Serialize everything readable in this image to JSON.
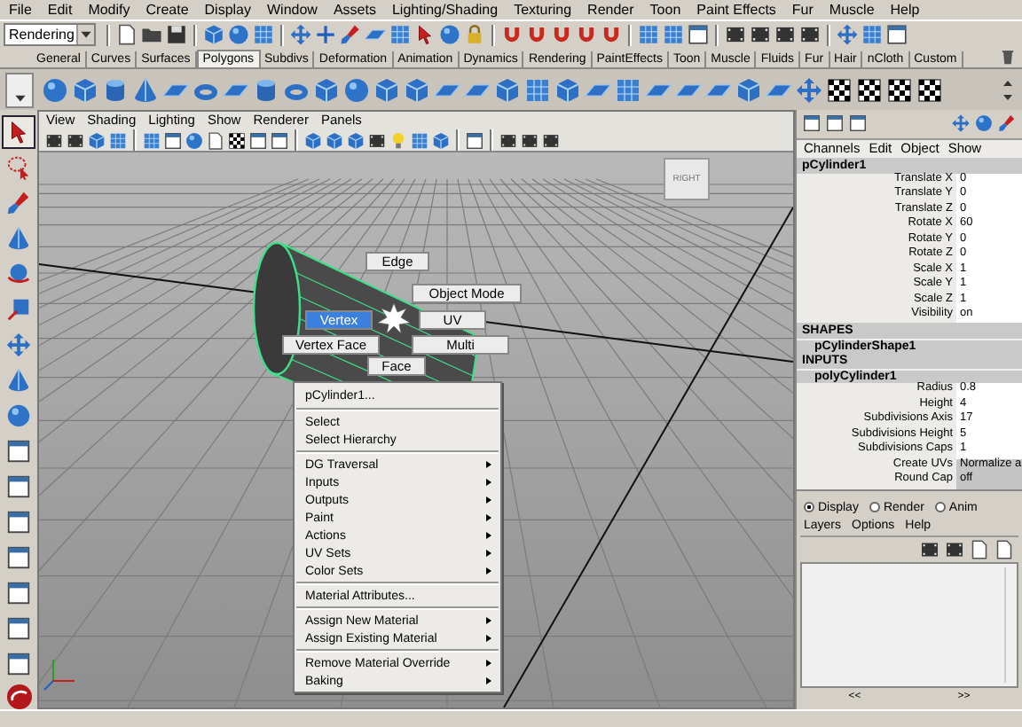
{
  "menubar": [
    "File",
    "Edit",
    "Modify",
    "Create",
    "Display",
    "Window",
    "Assets",
    "Lighting/Shading",
    "Texturing",
    "Render",
    "Toon",
    "Paint Effects",
    "Fur",
    "Muscle",
    "Help"
  ],
  "status_line": {
    "menu_set": "Rendering"
  },
  "shelf_tabs": [
    {
      "label": "General",
      "selected": false
    },
    {
      "label": "Curves",
      "selected": false
    },
    {
      "label": "Surfaces",
      "selected": false
    },
    {
      "label": "Polygons",
      "selected": true
    },
    {
      "label": "Subdivs",
      "selected": false
    },
    {
      "label": "Deformation",
      "selected": false
    },
    {
      "label": "Animation",
      "selected": false
    },
    {
      "label": "Dynamics",
      "selected": false
    },
    {
      "label": "Rendering",
      "selected": false
    },
    {
      "label": "PaintEffects",
      "selected": false
    },
    {
      "label": "Toon",
      "selected": false
    },
    {
      "label": "Muscle",
      "selected": false
    },
    {
      "label": "Fluids",
      "selected": false
    },
    {
      "label": "Fur",
      "selected": false
    },
    {
      "label": "Hair",
      "selected": false
    },
    {
      "label": "nCloth",
      "selected": false
    },
    {
      "label": "Custom",
      "selected": false
    }
  ],
  "toolbox": [
    {
      "selected": true
    },
    {
      "selected": false
    },
    {
      "selected": false
    },
    {
      "selected": false
    },
    {
      "selected": false
    },
    {
      "selected": false
    },
    {
      "selected": false
    },
    {
      "selected": false
    },
    {
      "selected": false
    },
    {
      "selected": false
    },
    {
      "selected": false
    },
    {
      "selected": false
    },
    {
      "selected": false
    },
    {
      "selected": false
    },
    {
      "selected": false
    },
    {
      "selected": false
    }
  ],
  "viewport": {
    "menus": [
      "View",
      "Shading",
      "Lighting",
      "Show",
      "Renderer",
      "Panels"
    ],
    "viewcube_label": "RIGHT",
    "marking_menu": [
      {
        "label": "Edge",
        "selected": false
      },
      {
        "label": "Object Mode",
        "selected": false
      },
      {
        "label": "Vertex",
        "selected": true
      },
      {
        "label": "UV",
        "selected": false
      },
      {
        "label": "Vertex Face",
        "selected": false
      },
      {
        "label": "Multi",
        "selected": false
      },
      {
        "label": "Face",
        "selected": false
      }
    ],
    "context_menu": [
      {
        "kind": "header",
        "label": "pCylinder1..."
      },
      {
        "kind": "separator"
      },
      {
        "kind": "item",
        "label": "Select"
      },
      {
        "kind": "item",
        "label": "Select Hierarchy"
      },
      {
        "kind": "separator"
      },
      {
        "kind": "submenu",
        "label": "DG Traversal"
      },
      {
        "kind": "submenu",
        "label": "Inputs"
      },
      {
        "kind": "submenu",
        "label": "Outputs"
      },
      {
        "kind": "submenu",
        "label": "Paint"
      },
      {
        "kind": "submenu",
        "label": "Actions"
      },
      {
        "kind": "submenu",
        "label": "UV Sets"
      },
      {
        "kind": "submenu",
        "label": "Color Sets"
      },
      {
        "kind": "separator"
      },
      {
        "kind": "item",
        "label": "Material Attributes..."
      },
      {
        "kind": "separator"
      },
      {
        "kind": "submenu",
        "label": "Assign New Material"
      },
      {
        "kind": "submenu",
        "label": "Assign Existing Material"
      },
      {
        "kind": "separator"
      },
      {
        "kind": "submenu",
        "label": "Remove Material Override"
      },
      {
        "kind": "submenu",
        "label": "Baking"
      }
    ]
  },
  "channel_box": {
    "menus": [
      "Channels",
      "Edit",
      "Object",
      "Show"
    ],
    "object": "pCylinder1",
    "attributes": [
      {
        "label": "Translate X",
        "value": "0",
        "kind": "number"
      },
      {
        "label": "Translate Y",
        "value": "0",
        "kind": "number"
      },
      {
        "label": "Translate Z",
        "value": "0",
        "kind": "number"
      },
      {
        "label": "Rotate X",
        "value": "60",
        "kind": "number"
      },
      {
        "label": "Rotate Y",
        "value": "0",
        "kind": "number"
      },
      {
        "label": "Rotate Z",
        "value": "0",
        "kind": "number"
      },
      {
        "label": "Scale X",
        "value": "1",
        "kind": "number"
      },
      {
        "label": "Scale Y",
        "value": "1",
        "kind": "number"
      },
      {
        "label": "Scale Z",
        "value": "1",
        "kind": "number"
      },
      {
        "label": "Visibility",
        "value": "on",
        "kind": "number"
      }
    ],
    "shapes_header": "SHAPES",
    "shape": "pCylinderShape1",
    "inputs_header": "INPUTS",
    "input": "polyCylinder1",
    "input_attributes": [
      {
        "label": "Radius",
        "value": "0.8",
        "kind": "number"
      },
      {
        "label": "Height",
        "value": "4",
        "kind": "number"
      },
      {
        "label": "Subdivisions Axis",
        "value": "17",
        "kind": "number"
      },
      {
        "label": "Subdivisions Height",
        "value": "5",
        "kind": "number"
      },
      {
        "label": "Subdivisions Caps",
        "value": "1",
        "kind": "number"
      },
      {
        "label": "Create UVs",
        "value": "Normalize a",
        "kind": "enum"
      },
      {
        "label": "Round Cap",
        "value": "off",
        "kind": "enum"
      }
    ]
  },
  "layer_editor": {
    "modes": [
      {
        "label": "Display",
        "selected": true
      },
      {
        "label": "Render",
        "selected": false
      },
      {
        "label": "Anim",
        "selected": false
      }
    ],
    "menus": [
      "Layers",
      "Options",
      "Help"
    ],
    "scroll_buttons": [
      "<<",
      ">>"
    ]
  }
}
